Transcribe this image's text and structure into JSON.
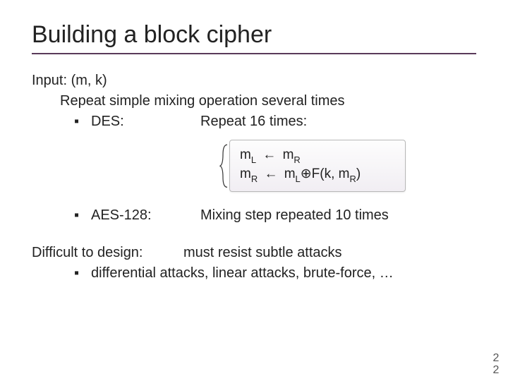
{
  "title": "Building a block cipher",
  "input_line": "Input:  (m, k)",
  "repeat_line": "Repeat simple mixing operation several times",
  "des": {
    "label": "DES:",
    "detail": "Repeat  16  times:"
  },
  "formula": {
    "line1_lhs_base": "m",
    "line1_lhs_sub": "L",
    "arrow": "←",
    "line1_rhs_base": "m",
    "line1_rhs_sub": "R",
    "line2_lhs_base": "m",
    "line2_lhs_sub": "R",
    "line2_rhs_a_base": "m",
    "line2_rhs_a_sub": "L",
    "xor": "⊕",
    "line2_func": "F(k, m",
    "line2_func_sub": "R",
    "line2_func_close": ")"
  },
  "aes": {
    "label": "AES-128:",
    "detail": "Mixing step repeated 10 times"
  },
  "difficult": {
    "lead": "Difficult to design:",
    "tail": "must resist subtle attacks",
    "bullet_text": "differential attacks,  linear attacks, brute-force,  …"
  },
  "bullet_glyph": "▪",
  "page_number": "22"
}
